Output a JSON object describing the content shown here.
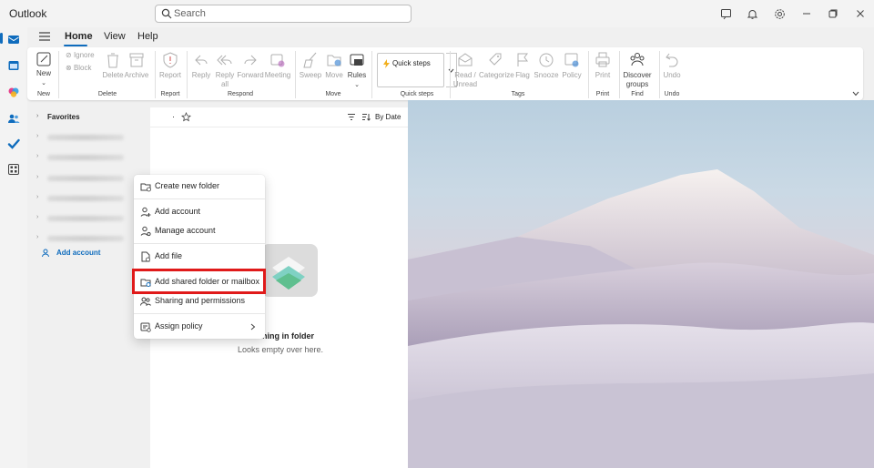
{
  "app": {
    "title": "Outlook"
  },
  "search": {
    "placeholder": "Search"
  },
  "tabs": [
    {
      "label": "Home"
    },
    {
      "label": "View"
    },
    {
      "label": "Help"
    }
  ],
  "ribbon": {
    "new": "New",
    "ignore": "Ignore",
    "block": "Block",
    "delete": "Delete",
    "archive": "Archive",
    "report": "Report",
    "reply": "Reply",
    "reply_all_1": "Reply",
    "reply_all_2": "all",
    "forward": "Forward",
    "meeting": "Meeting",
    "sweep": "Sweep",
    "move": "Move",
    "rules": "Rules",
    "quick_steps": "Quick steps",
    "read_unread_1": "Read /",
    "read_unread_2": "Unread",
    "categorize": "Categorize",
    "flag": "Flag",
    "snooze": "Snooze",
    "policy": "Policy",
    "print": "Print",
    "discover_1": "Discover",
    "discover_2": "groups",
    "undo": "Undo",
    "groups": {
      "new": "New",
      "delete": "Delete",
      "report": "Report",
      "respond": "Respond",
      "move": "Move",
      "quick_steps": "Quick steps",
      "tags": "Tags",
      "print": "Print",
      "find": "Find",
      "undo": "Undo"
    }
  },
  "folders": {
    "favorites": "Favorites",
    "add_account": "Add account"
  },
  "message_list": {
    "dot": "·",
    "sort": "By Date",
    "empty_title": "Nothing in folder",
    "empty_subtitle": "Looks empty over here."
  },
  "context_menu": {
    "items": [
      {
        "label": "Create new folder"
      },
      {
        "label": "Add account"
      },
      {
        "label": "Manage account"
      },
      {
        "label": "Add file"
      },
      {
        "label": "Add shared folder or mailbox"
      },
      {
        "label": "Sharing and permissions"
      },
      {
        "label": "Assign policy"
      }
    ]
  },
  "colors": {
    "accent": "#0f6cbd",
    "highlight": "#e01a1a"
  }
}
